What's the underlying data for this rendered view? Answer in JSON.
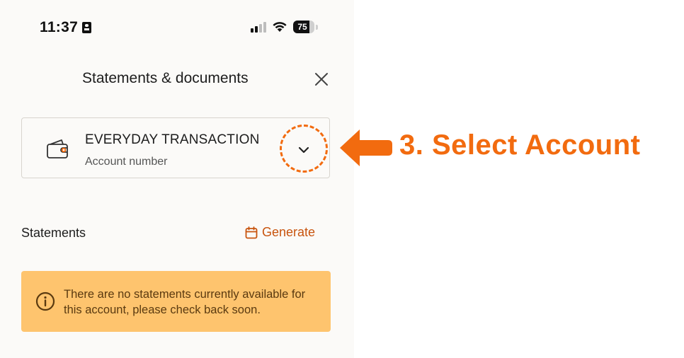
{
  "status_bar": {
    "time": "11:37",
    "battery": "75",
    "battery_level": 0.75,
    "icons": [
      "contact-card-icon",
      "cellular-signal-icon",
      "wifi-icon",
      "battery-icon"
    ]
  },
  "header": {
    "title": "Statements & documents",
    "close_icon": "close-icon"
  },
  "account": {
    "name": "EVERYDAY TRANSACTION",
    "subtitle": "Account number",
    "icon": "wallet-icon",
    "dropdown_icon": "chevron-down-icon"
  },
  "statements": {
    "label": "Statements",
    "generate_label": "Generate",
    "generate_icon": "calendar-icon"
  },
  "notice": {
    "text": "There are no statements currently available for this account, please check back soon.",
    "icon": "info-icon"
  },
  "annotation": {
    "text": "3. Select Account",
    "icon": "arrow-left-icon"
  },
  "colors": {
    "accent": "#f26b0f",
    "link": "#c8540e",
    "notice_bg": "#fec46e"
  }
}
